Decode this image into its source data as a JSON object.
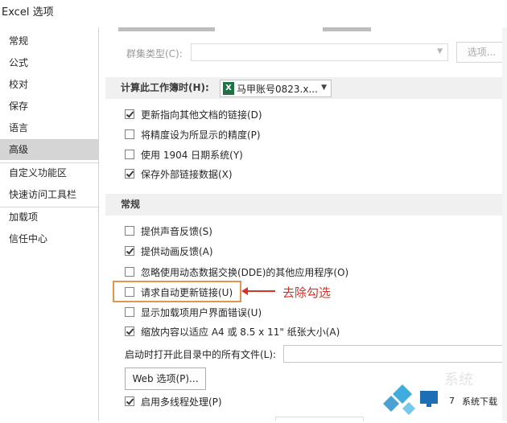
{
  "window": {
    "title": "Excel 选项"
  },
  "sidebar": {
    "items": [
      {
        "label": "常规",
        "active": false
      },
      {
        "label": "公式",
        "active": false
      },
      {
        "label": "校对",
        "active": false
      },
      {
        "label": "保存",
        "active": false
      },
      {
        "label": "语言",
        "active": false
      },
      {
        "label": "高级",
        "active": true
      },
      {
        "label": "自定义功能区",
        "active": false
      },
      {
        "label": "快速访问工具栏",
        "active": false
      },
      {
        "label": "加载项",
        "active": false
      },
      {
        "label": "信任中心",
        "active": false
      }
    ]
  },
  "cluster": {
    "label": "群集类型(C):",
    "button": "选项..."
  },
  "workbook_section": {
    "label": "计算此工作簿时(H):",
    "workbook": "马甲账号0823.x...",
    "options": [
      {
        "label": "更新指向其他文档的链接(D)",
        "checked": true
      },
      {
        "label": "将精度设为所显示的精度(P)",
        "checked": false
      },
      {
        "label": "使用 1904 日期系统(Y)",
        "checked": false
      },
      {
        "label": "保存外部链接数据(X)",
        "checked": true
      }
    ]
  },
  "general_section": {
    "header": "常规",
    "options": [
      {
        "label": "提供声音反馈(S)",
        "checked": false
      },
      {
        "label": "提供动画反馈(A)",
        "checked": true
      },
      {
        "label": "忽略使用动态数据交换(DDE)的其他应用程序(O)",
        "checked": false
      },
      {
        "label": "请求自动更新链接(U)",
        "checked": false
      },
      {
        "label": "显示加载项用户界面错误(U)",
        "checked": false
      },
      {
        "label": "缩放内容以适应 A4 或 8.5 x 11\" 纸张大小(A)",
        "checked": true
      }
    ],
    "startup_label": "启动时打开此目录中的所有文件(L):",
    "web_options_button": "Web 选项(P)...",
    "multithread": {
      "label": "启用多线程处理(P)",
      "checked": true
    }
  },
  "annotation": {
    "text": "去除勾选",
    "color": "#d93228"
  },
  "watermark": {
    "text": "系统下载"
  }
}
